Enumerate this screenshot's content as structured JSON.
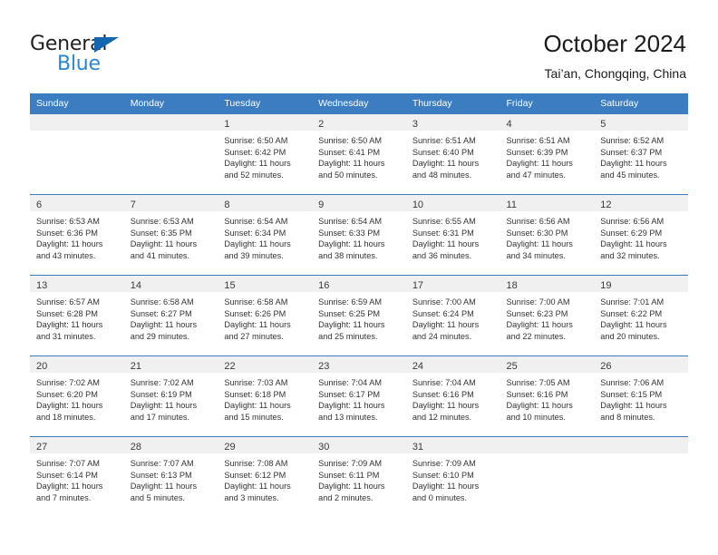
{
  "brand": {
    "name_top": "General",
    "name_bottom": "Blue",
    "triangle_color": "#1566b0",
    "text_color_top": "#231f20",
    "text_color_bottom": "#2a87d0"
  },
  "header": {
    "title": "October 2024",
    "subtitle": "Tai’an, Chongqing, China"
  },
  "theme": {
    "header_row_bg": "#3b7dc0",
    "header_row_text": "#ffffff",
    "daynum_band_bg": "#f0f0f0",
    "cell_border": "#3b7dc0"
  },
  "weekdays": [
    "Sunday",
    "Monday",
    "Tuesday",
    "Wednesday",
    "Thursday",
    "Friday",
    "Saturday"
  ],
  "weeks": [
    [
      {
        "day": "",
        "lines": []
      },
      {
        "day": "",
        "lines": []
      },
      {
        "day": "1",
        "lines": [
          "Sunrise: 6:50 AM",
          "Sunset: 6:42 PM",
          "Daylight: 11 hours",
          "and 52 minutes."
        ]
      },
      {
        "day": "2",
        "lines": [
          "Sunrise: 6:50 AM",
          "Sunset: 6:41 PM",
          "Daylight: 11 hours",
          "and 50 minutes."
        ]
      },
      {
        "day": "3",
        "lines": [
          "Sunrise: 6:51 AM",
          "Sunset: 6:40 PM",
          "Daylight: 11 hours",
          "and 48 minutes."
        ]
      },
      {
        "day": "4",
        "lines": [
          "Sunrise: 6:51 AM",
          "Sunset: 6:39 PM",
          "Daylight: 11 hours",
          "and 47 minutes."
        ]
      },
      {
        "day": "5",
        "lines": [
          "Sunrise: 6:52 AM",
          "Sunset: 6:37 PM",
          "Daylight: 11 hours",
          "and 45 minutes."
        ]
      }
    ],
    [
      {
        "day": "6",
        "lines": [
          "Sunrise: 6:53 AM",
          "Sunset: 6:36 PM",
          "Daylight: 11 hours",
          "and 43 minutes."
        ]
      },
      {
        "day": "7",
        "lines": [
          "Sunrise: 6:53 AM",
          "Sunset: 6:35 PM",
          "Daylight: 11 hours",
          "and 41 minutes."
        ]
      },
      {
        "day": "8",
        "lines": [
          "Sunrise: 6:54 AM",
          "Sunset: 6:34 PM",
          "Daylight: 11 hours",
          "and 39 minutes."
        ]
      },
      {
        "day": "9",
        "lines": [
          "Sunrise: 6:54 AM",
          "Sunset: 6:33 PM",
          "Daylight: 11 hours",
          "and 38 minutes."
        ]
      },
      {
        "day": "10",
        "lines": [
          "Sunrise: 6:55 AM",
          "Sunset: 6:31 PM",
          "Daylight: 11 hours",
          "and 36 minutes."
        ]
      },
      {
        "day": "11",
        "lines": [
          "Sunrise: 6:56 AM",
          "Sunset: 6:30 PM",
          "Daylight: 11 hours",
          "and 34 minutes."
        ]
      },
      {
        "day": "12",
        "lines": [
          "Sunrise: 6:56 AM",
          "Sunset: 6:29 PM",
          "Daylight: 11 hours",
          "and 32 minutes."
        ]
      }
    ],
    [
      {
        "day": "13",
        "lines": [
          "Sunrise: 6:57 AM",
          "Sunset: 6:28 PM",
          "Daylight: 11 hours",
          "and 31 minutes."
        ]
      },
      {
        "day": "14",
        "lines": [
          "Sunrise: 6:58 AM",
          "Sunset: 6:27 PM",
          "Daylight: 11 hours",
          "and 29 minutes."
        ]
      },
      {
        "day": "15",
        "lines": [
          "Sunrise: 6:58 AM",
          "Sunset: 6:26 PM",
          "Daylight: 11 hours",
          "and 27 minutes."
        ]
      },
      {
        "day": "16",
        "lines": [
          "Sunrise: 6:59 AM",
          "Sunset: 6:25 PM",
          "Daylight: 11 hours",
          "and 25 minutes."
        ]
      },
      {
        "day": "17",
        "lines": [
          "Sunrise: 7:00 AM",
          "Sunset: 6:24 PM",
          "Daylight: 11 hours",
          "and 24 minutes."
        ]
      },
      {
        "day": "18",
        "lines": [
          "Sunrise: 7:00 AM",
          "Sunset: 6:23 PM",
          "Daylight: 11 hours",
          "and 22 minutes."
        ]
      },
      {
        "day": "19",
        "lines": [
          "Sunrise: 7:01 AM",
          "Sunset: 6:22 PM",
          "Daylight: 11 hours",
          "and 20 minutes."
        ]
      }
    ],
    [
      {
        "day": "20",
        "lines": [
          "Sunrise: 7:02 AM",
          "Sunset: 6:20 PM",
          "Daylight: 11 hours",
          "and 18 minutes."
        ]
      },
      {
        "day": "21",
        "lines": [
          "Sunrise: 7:02 AM",
          "Sunset: 6:19 PM",
          "Daylight: 11 hours",
          "and 17 minutes."
        ]
      },
      {
        "day": "22",
        "lines": [
          "Sunrise: 7:03 AM",
          "Sunset: 6:18 PM",
          "Daylight: 11 hours",
          "and 15 minutes."
        ]
      },
      {
        "day": "23",
        "lines": [
          "Sunrise: 7:04 AM",
          "Sunset: 6:17 PM",
          "Daylight: 11 hours",
          "and 13 minutes."
        ]
      },
      {
        "day": "24",
        "lines": [
          "Sunrise: 7:04 AM",
          "Sunset: 6:16 PM",
          "Daylight: 11 hours",
          "and 12 minutes."
        ]
      },
      {
        "day": "25",
        "lines": [
          "Sunrise: 7:05 AM",
          "Sunset: 6:16 PM",
          "Daylight: 11 hours",
          "and 10 minutes."
        ]
      },
      {
        "day": "26",
        "lines": [
          "Sunrise: 7:06 AM",
          "Sunset: 6:15 PM",
          "Daylight: 11 hours",
          "and 8 minutes."
        ]
      }
    ],
    [
      {
        "day": "27",
        "lines": [
          "Sunrise: 7:07 AM",
          "Sunset: 6:14 PM",
          "Daylight: 11 hours",
          "and 7 minutes."
        ]
      },
      {
        "day": "28",
        "lines": [
          "Sunrise: 7:07 AM",
          "Sunset: 6:13 PM",
          "Daylight: 11 hours",
          "and 5 minutes."
        ]
      },
      {
        "day": "29",
        "lines": [
          "Sunrise: 7:08 AM",
          "Sunset: 6:12 PM",
          "Daylight: 11 hours",
          "and 3 minutes."
        ]
      },
      {
        "day": "30",
        "lines": [
          "Sunrise: 7:09 AM",
          "Sunset: 6:11 PM",
          "Daylight: 11 hours",
          "and 2 minutes."
        ]
      },
      {
        "day": "31",
        "lines": [
          "Sunrise: 7:09 AM",
          "Sunset: 6:10 PM",
          "Daylight: 11 hours",
          "and 0 minutes."
        ]
      },
      {
        "day": "",
        "lines": []
      },
      {
        "day": "",
        "lines": []
      }
    ]
  ]
}
